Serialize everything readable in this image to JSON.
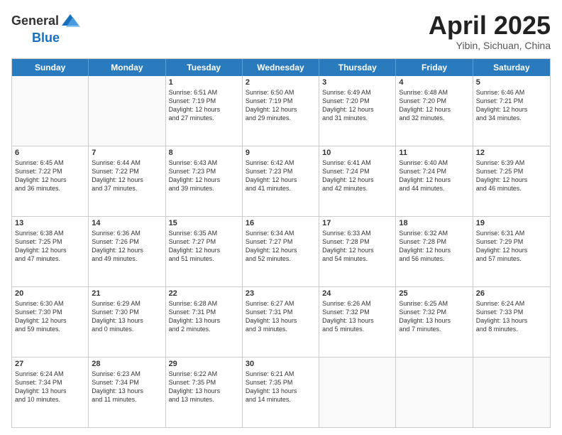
{
  "header": {
    "logo_general": "General",
    "logo_blue": "Blue",
    "title": "April 2025",
    "location": "Yibin, Sichuan, China"
  },
  "weekdays": [
    "Sunday",
    "Monday",
    "Tuesday",
    "Wednesday",
    "Thursday",
    "Friday",
    "Saturday"
  ],
  "rows": [
    [
      {
        "day": "",
        "text": ""
      },
      {
        "day": "",
        "text": ""
      },
      {
        "day": "1",
        "text": "Sunrise: 6:51 AM\nSunset: 7:19 PM\nDaylight: 12 hours\nand 27 minutes."
      },
      {
        "day": "2",
        "text": "Sunrise: 6:50 AM\nSunset: 7:19 PM\nDaylight: 12 hours\nand 29 minutes."
      },
      {
        "day": "3",
        "text": "Sunrise: 6:49 AM\nSunset: 7:20 PM\nDaylight: 12 hours\nand 31 minutes."
      },
      {
        "day": "4",
        "text": "Sunrise: 6:48 AM\nSunset: 7:20 PM\nDaylight: 12 hours\nand 32 minutes."
      },
      {
        "day": "5",
        "text": "Sunrise: 6:46 AM\nSunset: 7:21 PM\nDaylight: 12 hours\nand 34 minutes."
      }
    ],
    [
      {
        "day": "6",
        "text": "Sunrise: 6:45 AM\nSunset: 7:22 PM\nDaylight: 12 hours\nand 36 minutes."
      },
      {
        "day": "7",
        "text": "Sunrise: 6:44 AM\nSunset: 7:22 PM\nDaylight: 12 hours\nand 37 minutes."
      },
      {
        "day": "8",
        "text": "Sunrise: 6:43 AM\nSunset: 7:23 PM\nDaylight: 12 hours\nand 39 minutes."
      },
      {
        "day": "9",
        "text": "Sunrise: 6:42 AM\nSunset: 7:23 PM\nDaylight: 12 hours\nand 41 minutes."
      },
      {
        "day": "10",
        "text": "Sunrise: 6:41 AM\nSunset: 7:24 PM\nDaylight: 12 hours\nand 42 minutes."
      },
      {
        "day": "11",
        "text": "Sunrise: 6:40 AM\nSunset: 7:24 PM\nDaylight: 12 hours\nand 44 minutes."
      },
      {
        "day": "12",
        "text": "Sunrise: 6:39 AM\nSunset: 7:25 PM\nDaylight: 12 hours\nand 46 minutes."
      }
    ],
    [
      {
        "day": "13",
        "text": "Sunrise: 6:38 AM\nSunset: 7:25 PM\nDaylight: 12 hours\nand 47 minutes."
      },
      {
        "day": "14",
        "text": "Sunrise: 6:36 AM\nSunset: 7:26 PM\nDaylight: 12 hours\nand 49 minutes."
      },
      {
        "day": "15",
        "text": "Sunrise: 6:35 AM\nSunset: 7:27 PM\nDaylight: 12 hours\nand 51 minutes."
      },
      {
        "day": "16",
        "text": "Sunrise: 6:34 AM\nSunset: 7:27 PM\nDaylight: 12 hours\nand 52 minutes."
      },
      {
        "day": "17",
        "text": "Sunrise: 6:33 AM\nSunset: 7:28 PM\nDaylight: 12 hours\nand 54 minutes."
      },
      {
        "day": "18",
        "text": "Sunrise: 6:32 AM\nSunset: 7:28 PM\nDaylight: 12 hours\nand 56 minutes."
      },
      {
        "day": "19",
        "text": "Sunrise: 6:31 AM\nSunset: 7:29 PM\nDaylight: 12 hours\nand 57 minutes."
      }
    ],
    [
      {
        "day": "20",
        "text": "Sunrise: 6:30 AM\nSunset: 7:30 PM\nDaylight: 12 hours\nand 59 minutes."
      },
      {
        "day": "21",
        "text": "Sunrise: 6:29 AM\nSunset: 7:30 PM\nDaylight: 13 hours\nand 0 minutes."
      },
      {
        "day": "22",
        "text": "Sunrise: 6:28 AM\nSunset: 7:31 PM\nDaylight: 13 hours\nand 2 minutes."
      },
      {
        "day": "23",
        "text": "Sunrise: 6:27 AM\nSunset: 7:31 PM\nDaylight: 13 hours\nand 3 minutes."
      },
      {
        "day": "24",
        "text": "Sunrise: 6:26 AM\nSunset: 7:32 PM\nDaylight: 13 hours\nand 5 minutes."
      },
      {
        "day": "25",
        "text": "Sunrise: 6:25 AM\nSunset: 7:32 PM\nDaylight: 13 hours\nand 7 minutes."
      },
      {
        "day": "26",
        "text": "Sunrise: 6:24 AM\nSunset: 7:33 PM\nDaylight: 13 hours\nand 8 minutes."
      }
    ],
    [
      {
        "day": "27",
        "text": "Sunrise: 6:24 AM\nSunset: 7:34 PM\nDaylight: 13 hours\nand 10 minutes."
      },
      {
        "day": "28",
        "text": "Sunrise: 6:23 AM\nSunset: 7:34 PM\nDaylight: 13 hours\nand 11 minutes."
      },
      {
        "day": "29",
        "text": "Sunrise: 6:22 AM\nSunset: 7:35 PM\nDaylight: 13 hours\nand 13 minutes."
      },
      {
        "day": "30",
        "text": "Sunrise: 6:21 AM\nSunset: 7:35 PM\nDaylight: 13 hours\nand 14 minutes."
      },
      {
        "day": "",
        "text": ""
      },
      {
        "day": "",
        "text": ""
      },
      {
        "day": "",
        "text": ""
      }
    ]
  ]
}
